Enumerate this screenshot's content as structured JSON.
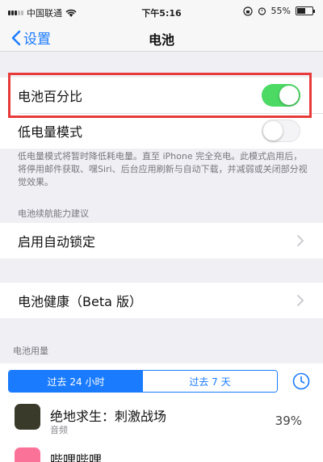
{
  "status": {
    "carrier": "中国联通",
    "time": "下午5:16",
    "battery_pct": "55%",
    "battery_level": 0.55
  },
  "nav": {
    "back_label": "设置",
    "title": "电池"
  },
  "settings": {
    "battery_percentage_label": "电池百分比",
    "battery_percentage_on": true,
    "low_power_label": "低电量模式",
    "low_power_on": false,
    "low_power_note": "低电量模式将暂时降低耗电量。直至 iPhone 完全充电。此模式启用后，将停用邮件获取、嘿Siri、后台应用刷新与自动下载，并减弱或关闭部分视觉效果。",
    "suggestions_header": "电池续航能力建议",
    "auto_lock_label": "启用自动锁定",
    "battery_health_label": "电池健康（Beta 版）"
  },
  "usage": {
    "header": "电池用量",
    "tabs": [
      "过去 24 小时",
      "过去 7 天"
    ],
    "active_tab": 0,
    "apps": [
      {
        "name": "绝地求生：刺激战场",
        "sub": "音频",
        "pct": "39%",
        "color": "#3a3a2a"
      },
      {
        "name": "哔哩哔哩",
        "sub": "",
        "pct": "",
        "color": "#fb7299"
      }
    ]
  },
  "colors": {
    "accent": "#1a7bff",
    "toggle_on": "#4cd964",
    "highlight": "#e83a3a"
  }
}
